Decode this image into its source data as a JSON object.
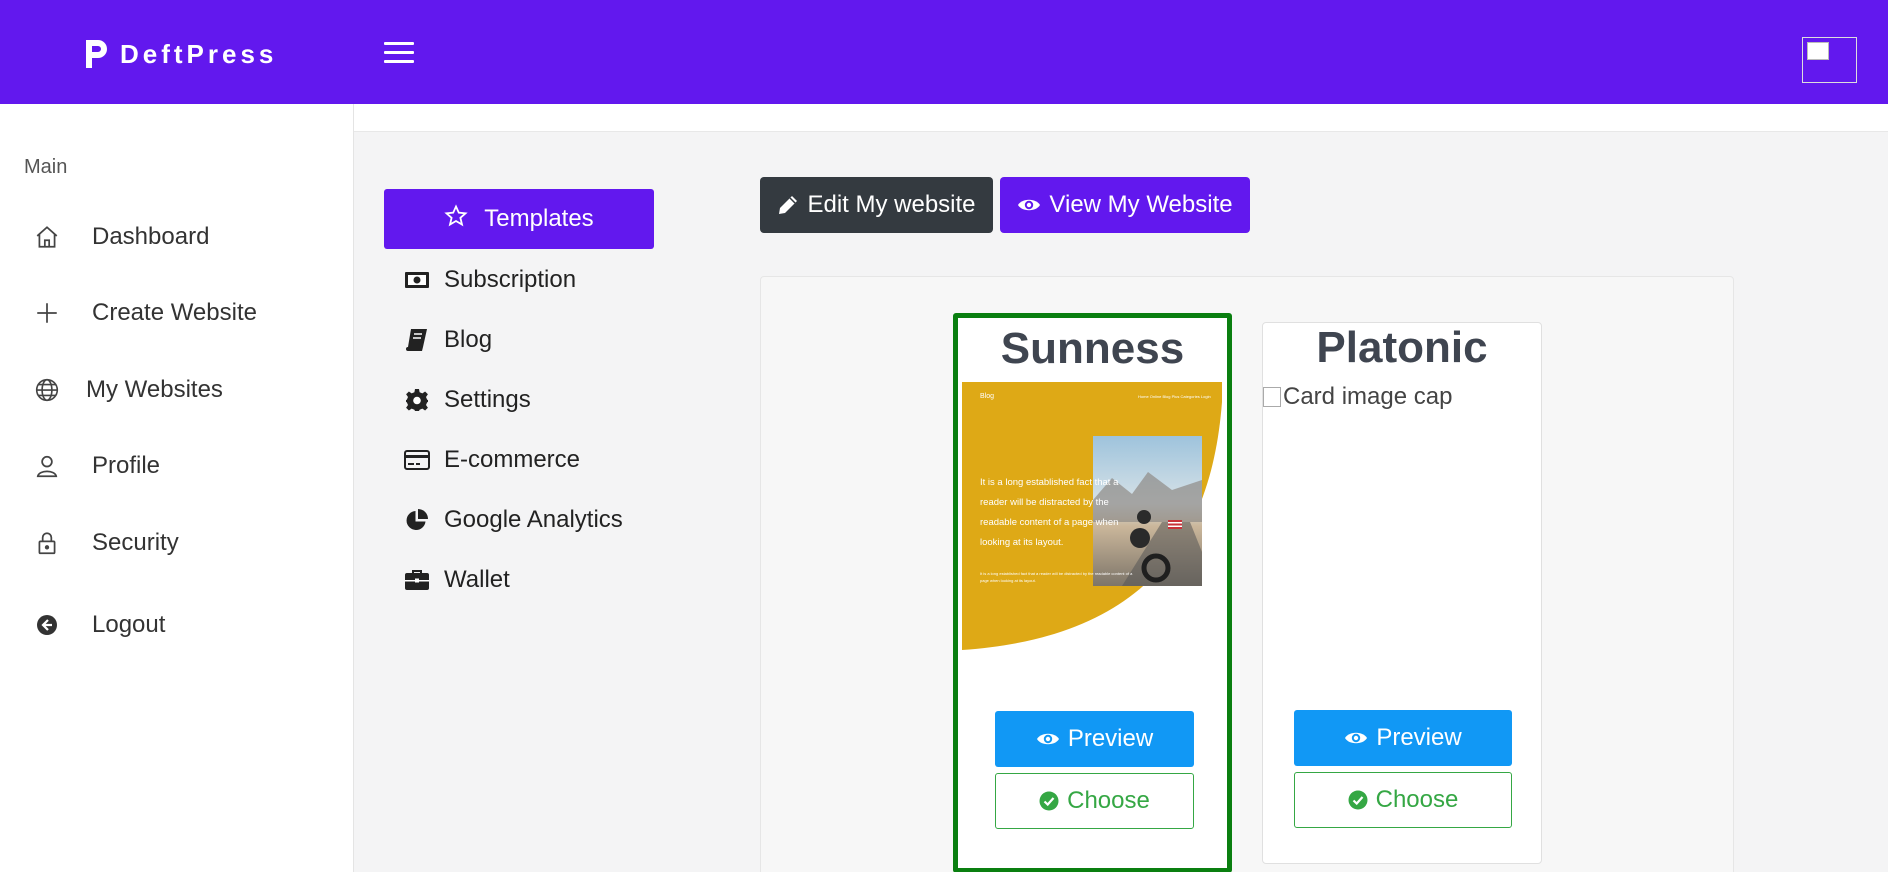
{
  "app": {
    "brand_name": "DeftPress"
  },
  "colors": {
    "primary": "#6218ee",
    "dark": "#343a40",
    "info": "#1198f5",
    "success": "#35a744",
    "selected_border": "#0a7f10"
  },
  "sidebar": {
    "section_label": "Main",
    "items": [
      {
        "label": "Dashboard",
        "icon": "home-icon"
      },
      {
        "label": "Create Website",
        "icon": "plus-icon"
      },
      {
        "label": "My Websites",
        "icon": "globe-icon"
      },
      {
        "label": "Profile",
        "icon": "user-icon"
      },
      {
        "label": "Security",
        "icon": "lock-icon"
      }
    ],
    "logout_label": "Logout"
  },
  "menu": {
    "active": {
      "label": "Templates",
      "icon": "star-icon"
    },
    "items": [
      {
        "label": "Subscription",
        "icon": "money-bill-icon"
      },
      {
        "label": "Blog",
        "icon": "book-icon"
      },
      {
        "label": "Settings",
        "icon": "gear-icon"
      },
      {
        "label": "E-commerce",
        "icon": "credit-card-icon"
      },
      {
        "label": "Google Analytics",
        "icon": "pie-chart-icon"
      },
      {
        "label": "Wallet",
        "icon": "briefcase-icon"
      }
    ]
  },
  "actions": {
    "edit_label": "Edit My website",
    "view_label": "View My Website"
  },
  "templates": [
    {
      "name": "Sunness",
      "selected": true,
      "thumbnail": {
        "nav_brand": "Blog",
        "nav_links": "Home  Online  Blog  Plus  Categories  Login",
        "headline": "It is a long established fact that a reader will be distracted by the readable content of a page when looking at its layout.",
        "subtext": "It is a long established fact that a reader will be distracted by the readable content of a page when looking at its layout."
      },
      "preview_label": "Preview",
      "choose_label": "Choose"
    },
    {
      "name": "Platonic",
      "selected": false,
      "image_alt": "Card image cap",
      "preview_label": "Preview",
      "choose_label": "Choose"
    }
  ]
}
